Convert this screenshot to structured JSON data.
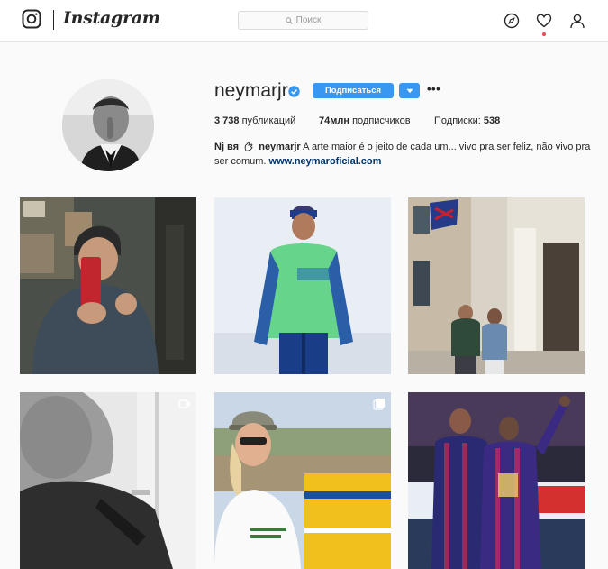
{
  "app": {
    "name": "Instagram"
  },
  "topbar": {
    "search_placeholder": "Поиск"
  },
  "profile": {
    "username": "neymarjr",
    "follow_label": "Подписаться",
    "more_label": "•••",
    "stats": {
      "posts_count": "3 738",
      "posts_label": "публикаций",
      "followers_count": "74млн",
      "followers_label": "подписчиков",
      "following_label": "Подписки:",
      "following_count": "538"
    },
    "bio": {
      "name": "Nj вя",
      "mention": "neymarjr",
      "text_line1": " A arte maior é o jeito de cada um... vivo pra ser feliz, não vivo pra",
      "text_line2": "ser comum. ",
      "link": "www.neymaroficial.com"
    }
  },
  "posts": [
    {
      "subject": "mirror-selfie",
      "type": "photo"
    },
    {
      "subject": "barca-training-kit",
      "type": "photo"
    },
    {
      "subject": "street-couple",
      "type": "photo"
    },
    {
      "subject": "bw-closeup-video",
      "type": "video"
    },
    {
      "subject": "woman-institute-shirt",
      "type": "gallery"
    },
    {
      "subject": "barca-players-celebrating",
      "type": "photo"
    }
  ],
  "colors": {
    "accent": "#3897f0",
    "link": "#003569",
    "notification": "#ed4956"
  }
}
